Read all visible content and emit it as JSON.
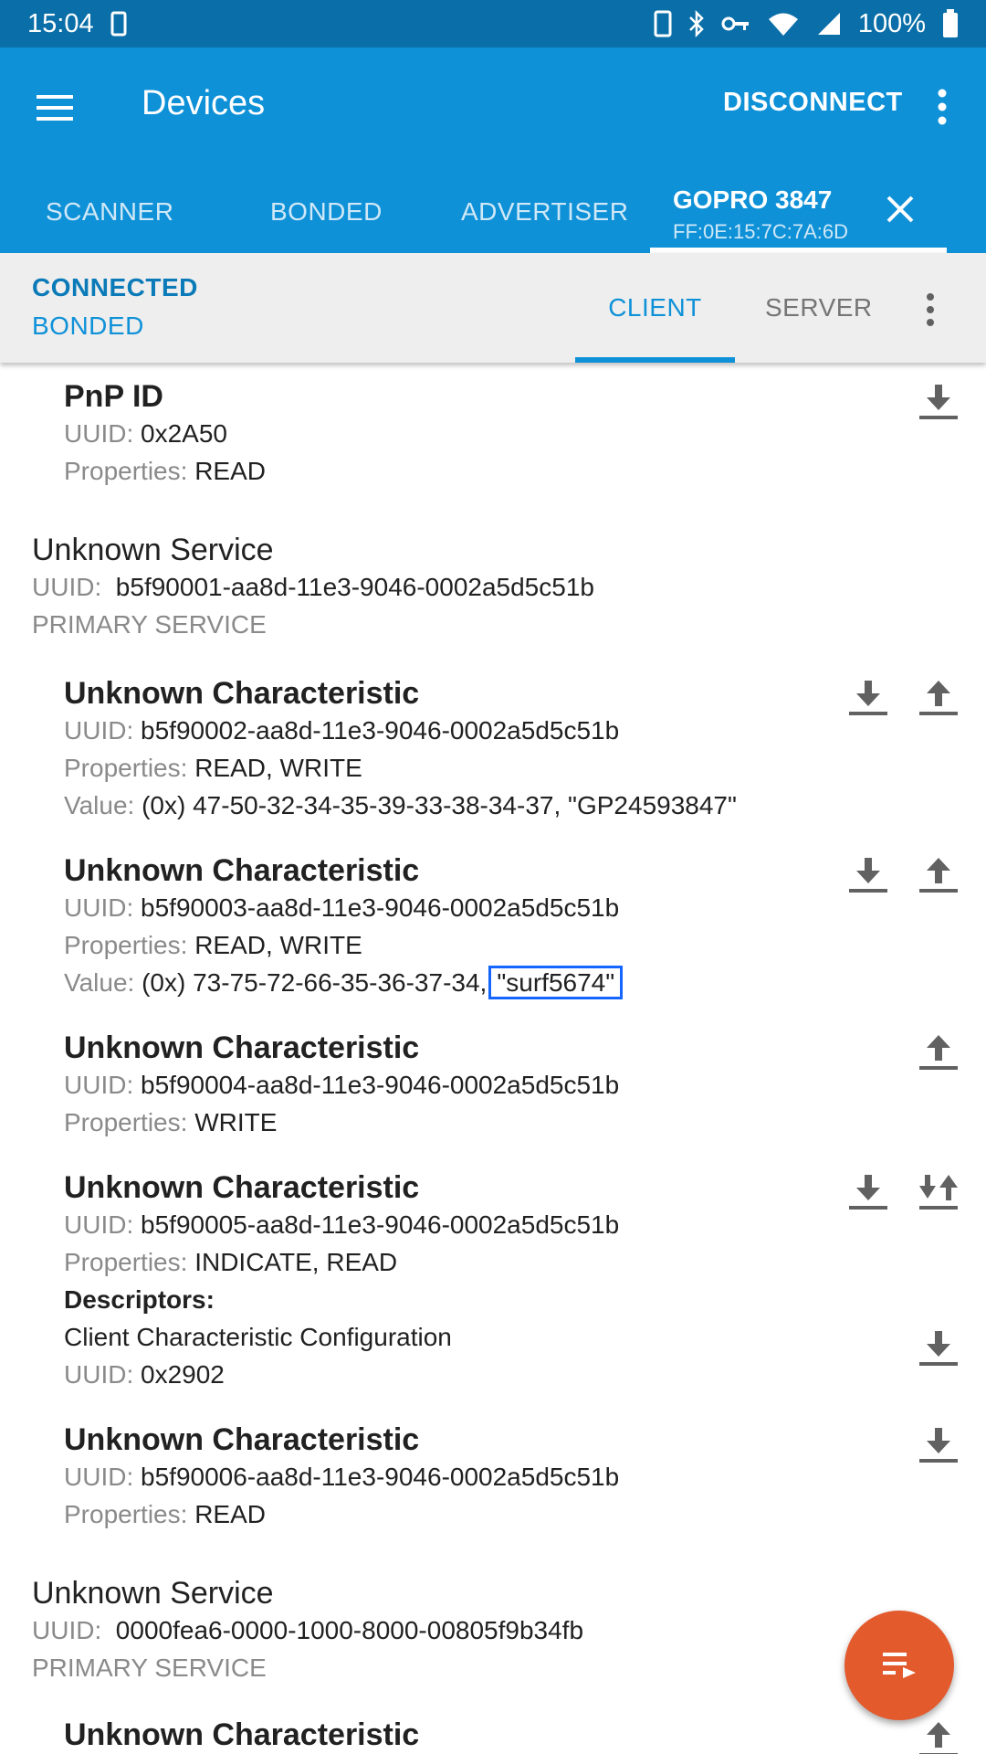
{
  "status_bar": {
    "time": "15:04",
    "battery": "100%"
  },
  "app_bar": {
    "title": "Devices",
    "disconnect_label": "DISCONNECT",
    "tabs": [
      "SCANNER",
      "BONDED",
      "ADVERTISER"
    ],
    "device_tab": {
      "name": "GOPRO 3847",
      "mac": "FF:0E:15:7C:7A:6D"
    }
  },
  "sub_bar": {
    "connection_state": "CONNECTED",
    "bond_state": "BONDED",
    "client_tab": "CLIENT",
    "server_tab": "SERVER"
  },
  "labels": {
    "uuid": "UUID:",
    "properties": "Properties:",
    "value": "Value:",
    "descriptors": "Descriptors:",
    "primary_service": "PRIMARY SERVICE"
  },
  "pnp": {
    "name": "PnP ID",
    "uuid": "0x2A50",
    "properties": "READ"
  },
  "service1": {
    "name": "Unknown Service",
    "uuid": "b5f90001-aa8d-11e3-9046-0002a5d5c51b",
    "characteristics": [
      {
        "name": "Unknown Characteristic",
        "uuid": "b5f90002-aa8d-11e3-9046-0002a5d5c51b",
        "properties": "READ, WRITE",
        "value": "(0x) 47-50-32-34-35-39-33-38-34-37, \"GP24593847\""
      },
      {
        "name": "Unknown Characteristic",
        "uuid": "b5f90003-aa8d-11e3-9046-0002a5d5c51b",
        "properties": "READ, WRITE",
        "value_hex": "(0x) 73-75-72-66-35-36-37-34,",
        "value_text": "\"surf5674\""
      },
      {
        "name": "Unknown Characteristic",
        "uuid": "b5f90004-aa8d-11e3-9046-0002a5d5c51b",
        "properties": "WRITE"
      },
      {
        "name": "Unknown Characteristic",
        "uuid": "b5f90005-aa8d-11e3-9046-0002a5d5c51b",
        "properties": "INDICATE, READ",
        "descriptor_name": "Client Characteristic Configuration",
        "descriptor_uuid": "0x2902"
      },
      {
        "name": "Unknown Characteristic",
        "uuid": "b5f90006-aa8d-11e3-9046-0002a5d5c51b",
        "properties": "READ"
      }
    ]
  },
  "service2": {
    "name": "Unknown Service",
    "uuid": "0000fea6-0000-1000-8000-00805f9b34fb",
    "characteristic_name": "Unknown Characteristic"
  },
  "colors": {
    "primary": "#0f91d8",
    "status_bar": "#0a6fa8",
    "fab": "#e35a2d",
    "highlight": "#1565ff"
  }
}
